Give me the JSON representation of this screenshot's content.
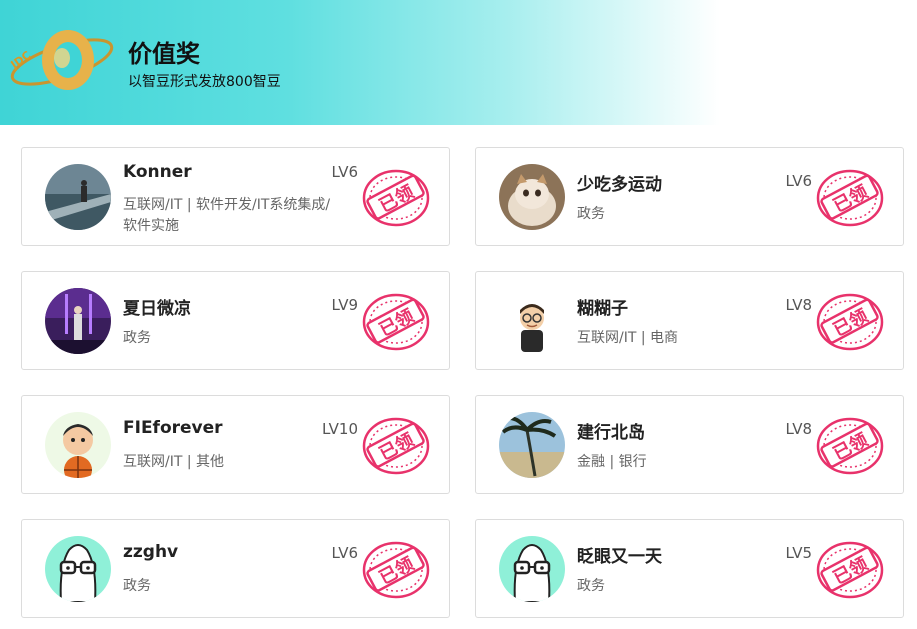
{
  "header": {
    "title": "价值奖",
    "subtitle": "以智豆形式发放800智豆",
    "medal_label": "JDC"
  },
  "stamp_text": "已领",
  "colors": {
    "stamp": "#e8326b",
    "banner_start": "#3fd4d6"
  },
  "winners": [
    {
      "name": "Konner",
      "level": "LV6",
      "industry_line1": "互联网/IT | 软件开发/IT系统集成/",
      "industry_line2": "软件实施",
      "avatar": "lake-photo-avatar"
    },
    {
      "name": "少吃多运动",
      "level": "LV6",
      "industry_line1": "政务",
      "industry_line2": "",
      "avatar": "cat-photo-avatar"
    },
    {
      "name": "夏日微凉",
      "level": "LV9",
      "industry_line1": "政务",
      "industry_line2": "",
      "avatar": "stage-photo-avatar"
    },
    {
      "name": "糊糊子",
      "level": "LV8",
      "industry_line1": "互联网/IT | 电商",
      "industry_line2": "",
      "avatar": "cartoon-man-avatar"
    },
    {
      "name": "FIEforever",
      "level": "LV10",
      "industry_line1": "互联网/IT | 其他",
      "industry_line2": "",
      "avatar": "basketball-cartoon-avatar"
    },
    {
      "name": "建行北岛",
      "level": "LV8",
      "industry_line1": "金融 | 银行",
      "industry_line2": "",
      "avatar": "palm-beach-avatar"
    },
    {
      "name": "zzghv",
      "level": "LV6",
      "industry_line1": "政务",
      "industry_line2": "",
      "avatar": "rabbit-glasses-avatar"
    },
    {
      "name": "眨眼又一天",
      "level": "LV5",
      "industry_line1": "政务",
      "industry_line2": "",
      "avatar": "rabbit-glasses-avatar"
    }
  ]
}
